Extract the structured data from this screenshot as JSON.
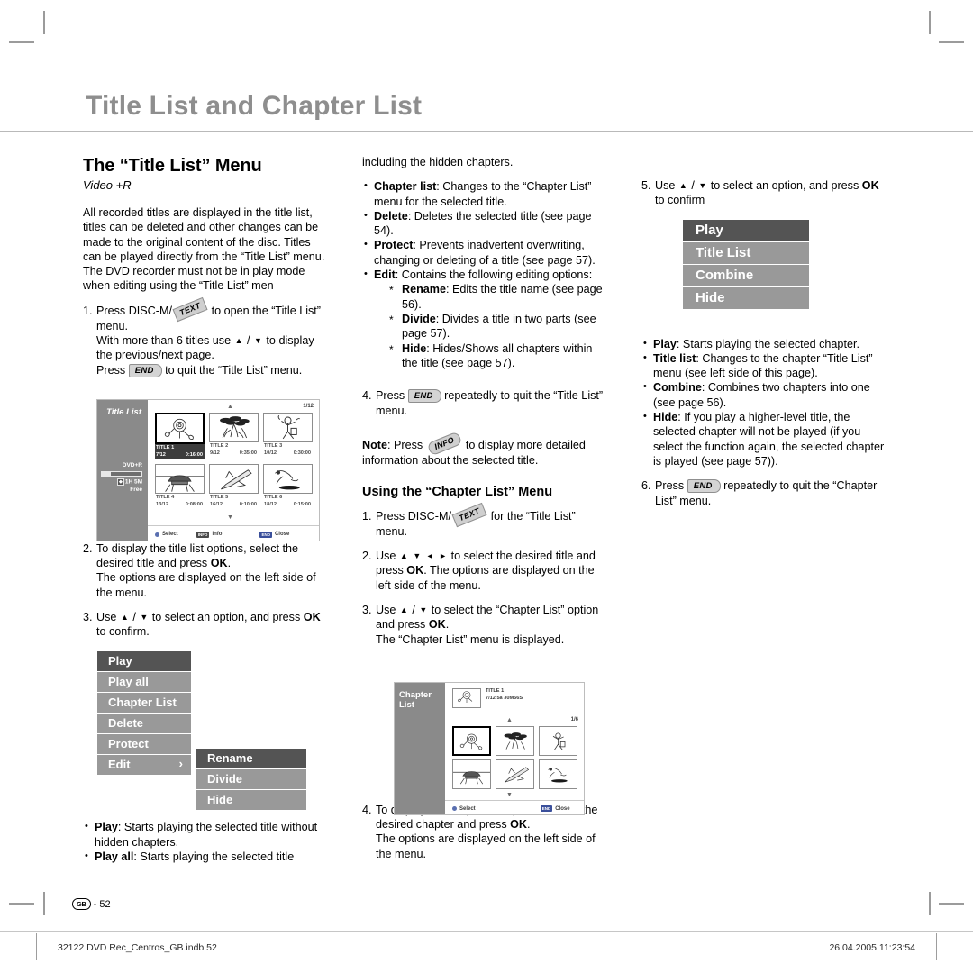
{
  "page": {
    "title": "Title List and Chapter List",
    "number_label": "- 52",
    "locale_badge": "GB",
    "footer_left": "32122 DVD Rec_Centros_GB.indb   52",
    "footer_right": "26.04.2005   11:23:54"
  },
  "left": {
    "section_heading": "The “Title List” Menu",
    "media_tag": "Video +R",
    "intro": "All recorded titles are displayed in the title list, titles can be deleted and other changes can be made to the original content of the disc. Titles can be played directly from the “Title List” menu. The DVD recorder must not be in play mode when editing using the “Title List” men",
    "step1": {
      "num": "1.",
      "a_pre": "Press DISC-M/",
      "key1": "TEXT",
      "a_post": " to open the “Title List” menu.",
      "b_pre": "With more than 6 titles use ",
      "b_post": " to display the previous/next page.",
      "c_pre": "Press ",
      "key2": "END",
      "c_post": " to quit the “Title List” menu."
    },
    "step2": {
      "num": "2.",
      "line1a": "To display the title list options, select the desired title and press ",
      "ok": "OK",
      "line1b": ".",
      "line2": "The options are displayed on the left side of the menu."
    },
    "step3": {
      "num": "3.",
      "a": "Use ",
      "b": " to select an option, and press ",
      "ok": "OK",
      "c": " to confirm."
    },
    "bullets": [
      {
        "term": "Play",
        "text": ": Starts playing the selected title without hidden chapters."
      },
      {
        "term": "Play all",
        "text": ": Starts playing the selected title"
      }
    ]
  },
  "mid": {
    "continued": "including the hidden chapters.",
    "bullets": [
      {
        "term": "Chapter list",
        "text": ": Changes to the “Chapter List” menu for the selected title."
      },
      {
        "term": "Delete",
        "text": ": Deletes the selected title (see page 54)."
      },
      {
        "term": "Protect",
        "text": ": Prevents inadvertent overwriting, changing or deleting of a title (see page 57)."
      },
      {
        "term": "Edit",
        "text": ": Contains the following editing options:"
      }
    ],
    "sub_bullets": [
      {
        "term": "Rename",
        "text": ": Edits the title name (see page 56)."
      },
      {
        "term": "Divide",
        "text": ": Divides a title in two parts (see page 57)."
      },
      {
        "term": "Hide",
        "text": ": Hides/Shows all chapters within the title (see page 57)."
      }
    ],
    "step4": {
      "num": "4.",
      "a": "Press ",
      "key": "END",
      "b": " repeatedly to quit the “Title List” menu."
    },
    "note": {
      "label": "Note",
      "a": ": Press ",
      "key": "INFO",
      "b": " to display more detailed information about the selected title."
    },
    "section_heading": "Using the “Chapter List” Menu",
    "c_step1": {
      "num": "1.",
      "a": "Press DISC-M/",
      "key": "TEXT",
      "b": " for the “Title List” menu."
    },
    "c_step2": {
      "num": "2.",
      "a": "Use ",
      "b": " to select the desired title and press ",
      "ok": "OK",
      "c": ". The options are displayed on the left side of the menu."
    },
    "c_step3": {
      "num": "3.",
      "a": "Use ",
      "b": " to select the “Chapter List” option and press ",
      "ok": "OK",
      "c": ".",
      "line2": "The “Chapter List” menu is displayed."
    },
    "c_step4": {
      "num": "4.",
      "line1a": "To display the chapter list options, select the desired chapter and press ",
      "ok": "OK",
      "line1b": ".",
      "line2": "The options are displayed on the left side of the menu."
    }
  },
  "right": {
    "step5": {
      "num": "5.",
      "a": "Use ",
      "b": " to select an option, and press ",
      "ok": "OK",
      "c": " to confirm"
    },
    "bullets": [
      {
        "term": "Play",
        "text": ": Starts playing the selected chapter."
      },
      {
        "term": "Title list",
        "text": ": Changes to the chapter “Title List” menu (see left side of this page)."
      },
      {
        "term": "Combine",
        "text": ": Combines two chapters into one (see page 56)."
      },
      {
        "term": "Hide",
        "text": ": If you play a higher-level title, the selected chapter will not be played (if you select the function again, the selected chapter is played (see page 57))."
      }
    ],
    "step6": {
      "num": "6.",
      "a": "Press ",
      "key": "END",
      "b": " repeatedly to quit the “Chapter List” menu."
    }
  },
  "osd": {
    "title_list_menu": {
      "items": [
        "Play",
        "Play all",
        "Chapter List",
        "Delete",
        "Protect",
        "Edit"
      ],
      "selected_index": 0,
      "submenu_arrow_index": 5
    },
    "edit_submenu": {
      "items": [
        "Rename",
        "Divide",
        "Hide"
      ],
      "selected_index": 0
    },
    "chapter_menu": {
      "items": [
        "Play",
        "Title List",
        "Combine",
        "Hide"
      ],
      "selected_index": 0
    }
  },
  "tv_title_list": {
    "side_label": "Title List",
    "disc_type": "DVD+R",
    "free_badge": "◊",
    "free_time": "1H 5M",
    "free_word": "Free",
    "page_indicator": "1/12",
    "thumbnails": [
      {
        "name": "TITLE 1",
        "date": "7/12",
        "time": "0:16:00",
        "icon": "rose",
        "selected": true
      },
      {
        "name": "TITLE 2",
        "date": "9/12",
        "time": "0:35:00",
        "icon": "flowers",
        "selected": false
      },
      {
        "name": "TITLE 3",
        "date": "10/12",
        "time": "0:30:00",
        "icon": "figure",
        "selected": false
      },
      {
        "name": "TITLE 4",
        "date": "13/12",
        "time": "0:08:00",
        "icon": "car",
        "selected": false
      },
      {
        "name": "TITLE 5",
        "date": "16/12",
        "time": "0:10:00",
        "icon": "shuttle",
        "selected": false
      },
      {
        "name": "TITLE 6",
        "date": "18/12",
        "time": "0:15:00",
        "icon": "dog",
        "selected": false
      }
    ],
    "status": [
      {
        "key": "●",
        "label": "Select",
        "style": "dot"
      },
      {
        "key": "INFO",
        "label": "Info",
        "style": "dark"
      },
      {
        "key": "END",
        "label": "Close",
        "style": "blue"
      }
    ]
  },
  "tv_chapter_list": {
    "side_label": "Chapter List",
    "header": {
      "title": "TITLE 1",
      "meta": "7/12  5a    30M56S",
      "icon": "rose"
    },
    "page_indicator": "1/6",
    "thumbnails": [
      {
        "icon": "rose",
        "selected": true
      },
      {
        "icon": "flowers",
        "selected": false
      },
      {
        "icon": "figure",
        "selected": false
      },
      {
        "icon": "car",
        "selected": false
      },
      {
        "icon": "shuttle",
        "selected": false
      },
      {
        "icon": "dog",
        "selected": false
      }
    ],
    "status": [
      {
        "key": "●",
        "label": "Select",
        "style": "dot"
      },
      {
        "key": "END",
        "label": "Close",
        "style": "blue"
      }
    ]
  },
  "colors": {
    "title_gray": "#8e8e8e",
    "menu_item": "#999999",
    "menu_selected": "#545454",
    "osd_sidebar": "#8a8a8a"
  }
}
